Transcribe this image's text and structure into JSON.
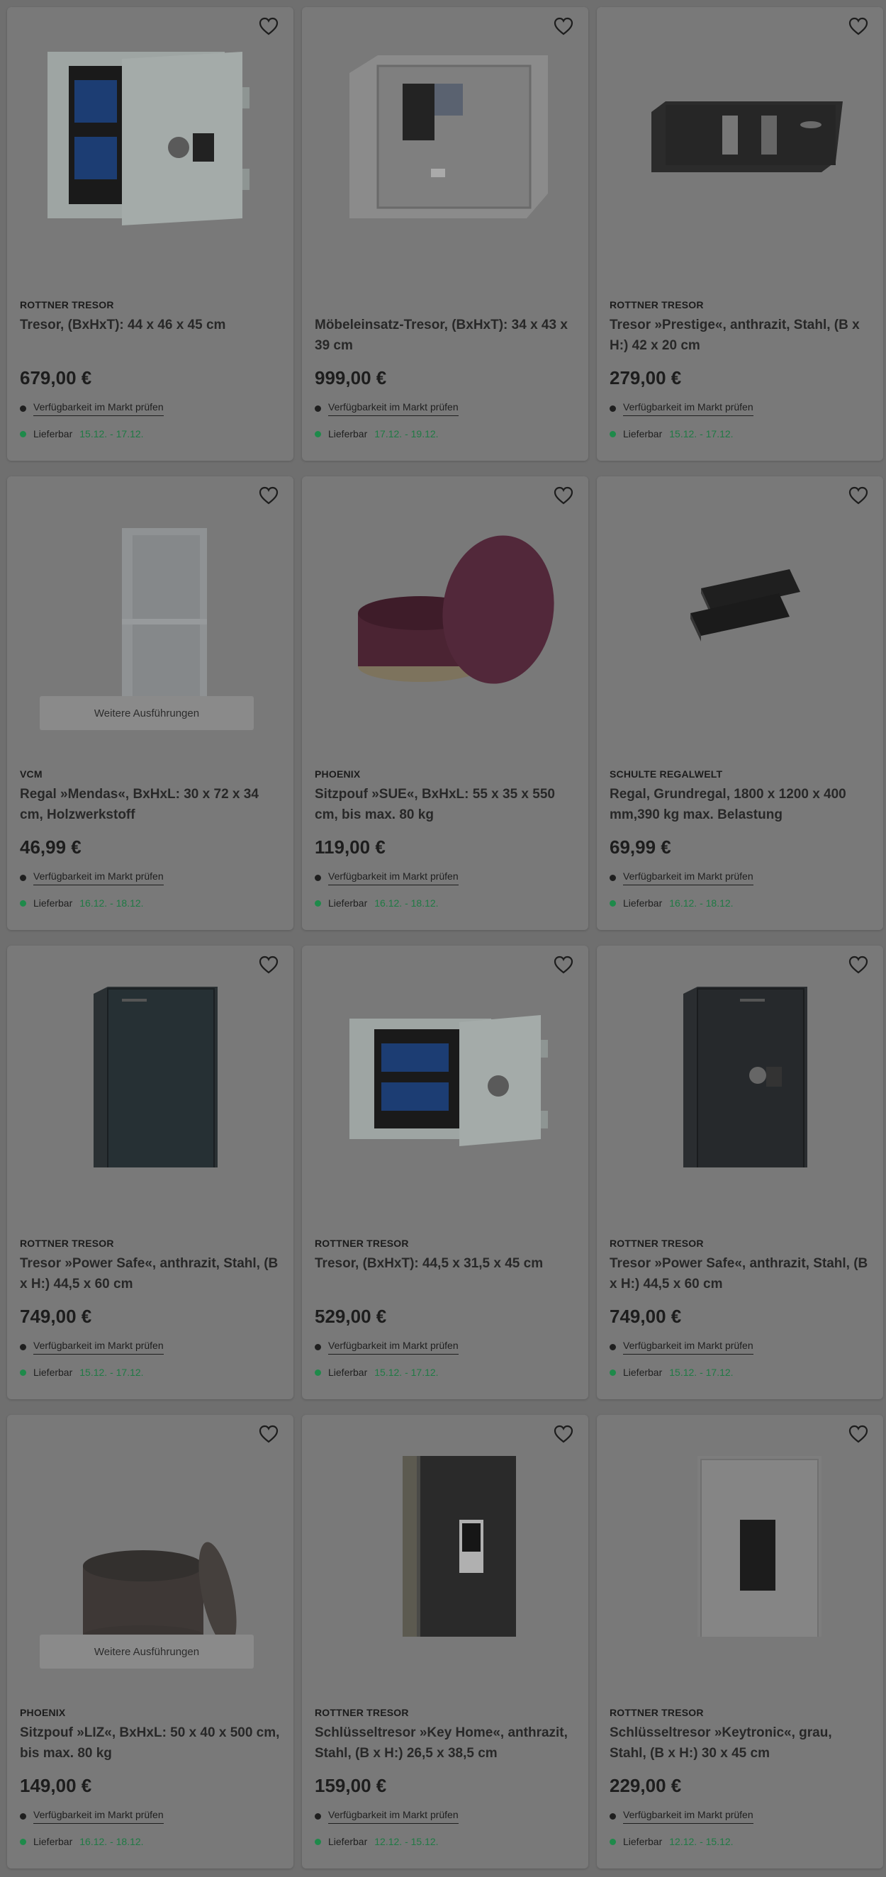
{
  "common": {
    "availability_label": "Verfügbarkeit im Markt prüfen",
    "delivery_label": "Lieferbar",
    "variants_label": "Weitere Ausführungen"
  },
  "colors": {
    "delivery_green": "#1e8a4a",
    "background": "#6f6f6f"
  },
  "products": [
    {
      "brand": "ROTTNER TRESOR",
      "title": "Tresor, (BxHxT): 44 x 46 x 45 cm",
      "price": "679,00 €",
      "dates": "15.12. - 17.12.",
      "image_icon": "open-safe-blue-interior"
    },
    {
      "brand": "",
      "title": "Möbeleinsatz-Tresor, (BxHxT): 34 x 43 x 39 cm",
      "price": "999,00 €",
      "dates": "17.12. - 19.12.",
      "image_icon": "grey-safe-keypad"
    },
    {
      "brand": "ROTTNER TRESOR",
      "title": "Tresor »Prestige«, anthrazit, Stahl, (B x H:) 42 x 20 cm",
      "price": "279,00 €",
      "dates": "15.12. - 17.12.",
      "image_icon": "flat-anthracite-safe"
    },
    {
      "brand": "VCM",
      "title": "Regal »Mendas«, BxHxL: 30 x 72 x 34 cm, Holzwerkstoff",
      "price": "46,99 €",
      "dates": "16.12. - 18.12.",
      "image_icon": "white-shelf",
      "has_variants": true
    },
    {
      "brand": "PHOENIX",
      "title": "Sitzpouf »SUE«, BxHxL: 55 x 35 x 550 cm, bis max. 80 kg",
      "price": "119,00 €",
      "dates": "16.12. - 18.12.",
      "image_icon": "burgundy-pouf"
    },
    {
      "brand": "SCHULTE REGALWELT",
      "title": "Regal, Grundregal, 1800 x 1200 x 400 mm,390 kg max. Belastung",
      "price": "69,99 €",
      "dates": "16.12. - 18.12.",
      "image_icon": "black-shelf-boards"
    },
    {
      "brand": "ROTTNER TRESOR",
      "title": "Tresor »Power Safe«, anthrazit, Stahl, (B x H:) 44,5 x 60 cm",
      "price": "749,00 €",
      "dates": "15.12. - 17.12.",
      "image_icon": "tall-anthracite-safe"
    },
    {
      "brand": "ROTTNER TRESOR",
      "title": "Tresor, (BxHxT): 44,5 x 31,5 x 45 cm",
      "price": "529,00 €",
      "dates": "15.12. - 17.12.",
      "image_icon": "open-safe-wide"
    },
    {
      "brand": "ROTTNER TRESOR",
      "title": "Tresor »Power Safe«, anthrazit, Stahl, (B x H:) 44,5 x 60 cm",
      "price": "749,00 €",
      "dates": "15.12. - 17.12.",
      "image_icon": "tall-anthracite-safe-keypad"
    },
    {
      "brand": "PHOENIX",
      "title": "Sitzpouf »LIZ«, BxHxL: 50 x 40 x 500 cm, bis max. 80 kg",
      "price": "149,00 €",
      "dates": "16.12. - 18.12.",
      "image_icon": "grey-pouf",
      "has_variants": true
    },
    {
      "brand": "ROTTNER TRESOR",
      "title": "Schlüsseltresor »Key Home«, anthrazit, Stahl, (B x H:) 26,5 x 38,5 cm",
      "price": "159,00 €",
      "dates": "12.12. - 15.12.",
      "image_icon": "key-safe-anthracite"
    },
    {
      "brand": "ROTTNER TRESOR",
      "title": "Schlüsseltresor »Keytronic«, grau, Stahl, (B x H:) 30 x 45 cm",
      "price": "229,00 €",
      "dates": "12.12. - 15.12.",
      "image_icon": "key-safe-grey"
    }
  ]
}
